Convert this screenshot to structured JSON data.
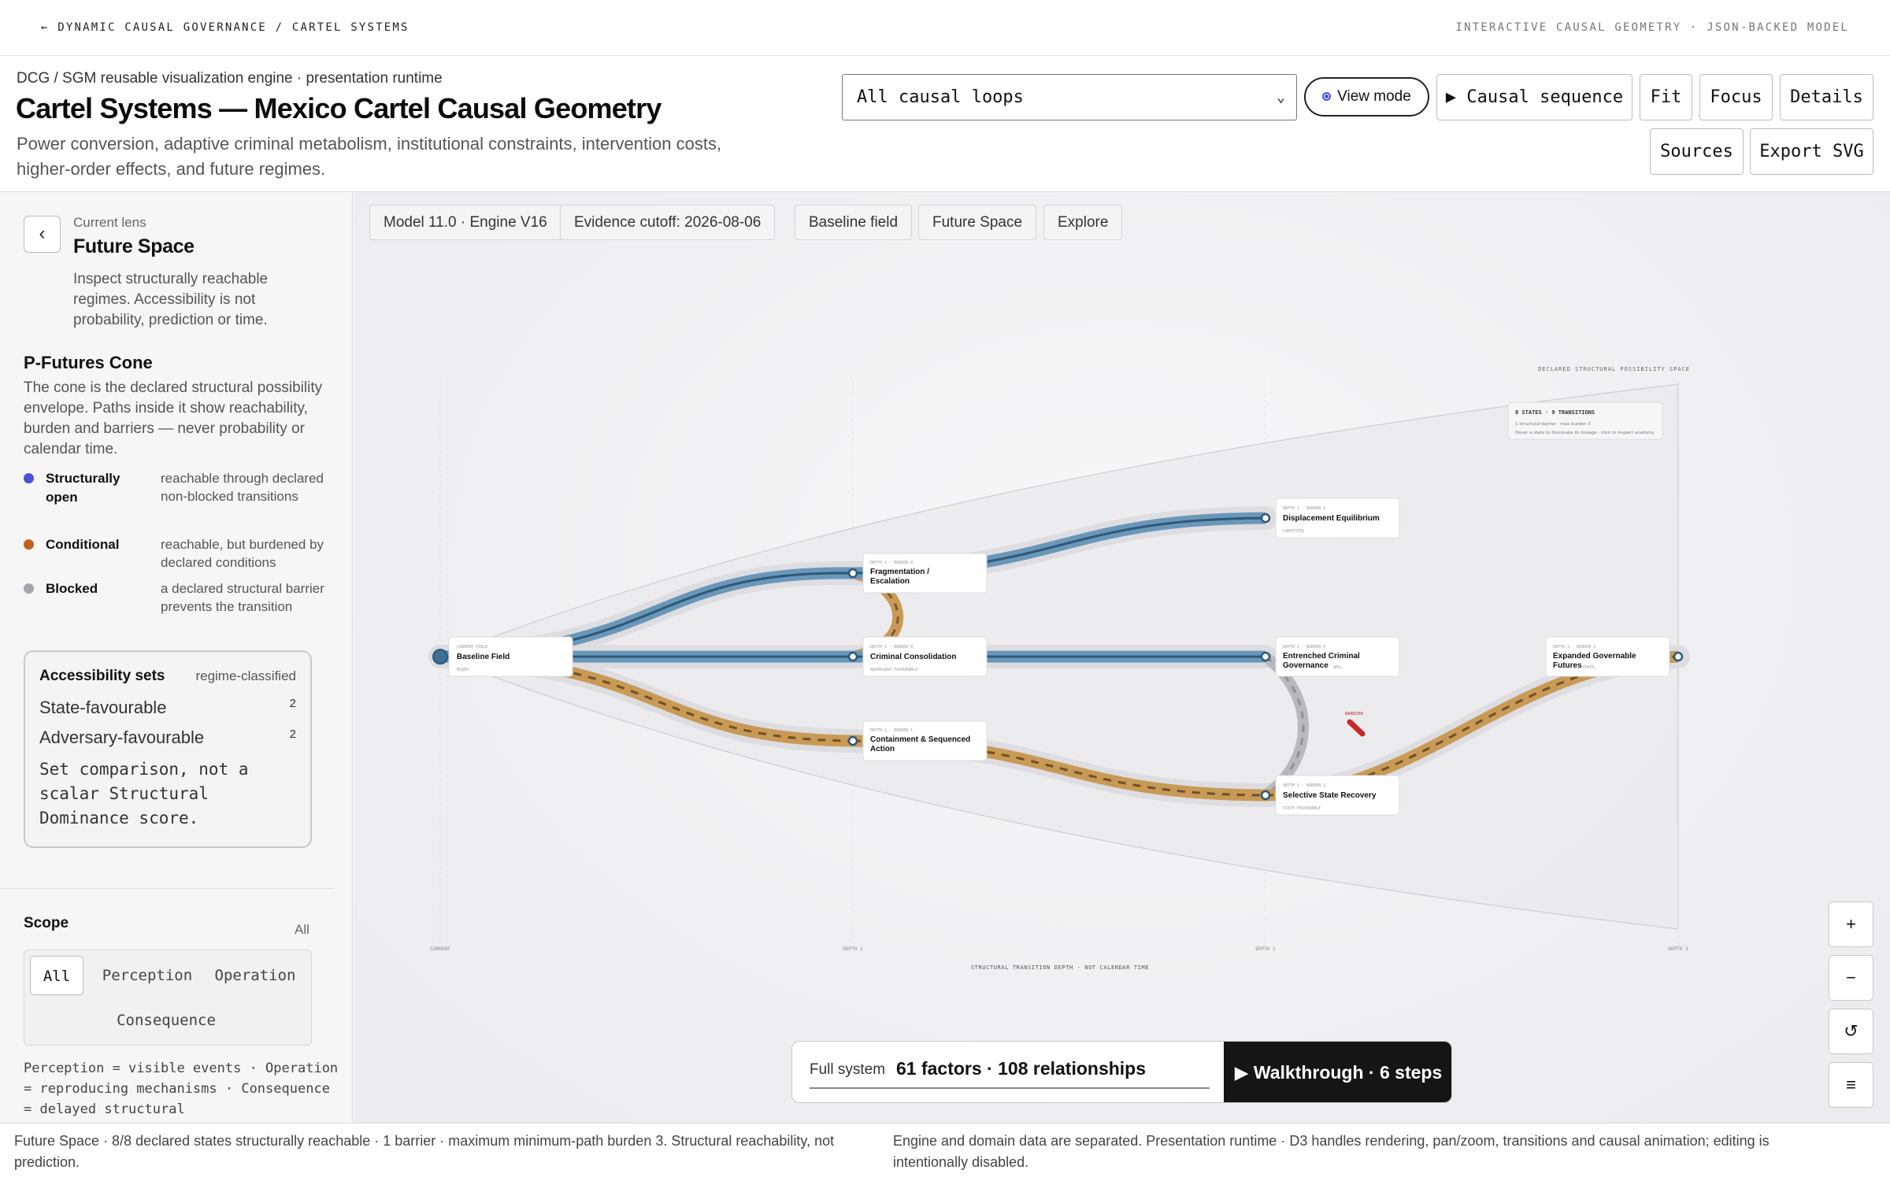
{
  "topbar": {
    "back": "← DYNAMIC CAUSAL GOVERNANCE / CARTEL SYSTEMS",
    "right": "INTERACTIVE CAUSAL GEOMETRY · JSON-BACKED MODEL"
  },
  "header": {
    "crumb": "DCG / SGM reusable visualization engine · presentation runtime",
    "title": "Cartel Systems — Mexico Cartel Causal Geometry",
    "subtitle": "Power conversion, adaptive criminal metabolism, institutional constraints, intervention costs, higher-order effects, and future regimes.",
    "loop_select": "All causal loops",
    "view_mode": "View mode",
    "buttons": {
      "causal_sequence": "▶ Causal sequence",
      "fit": "Fit",
      "focus": "Focus",
      "details": "Details",
      "sources": "Sources",
      "export": "Export SVG"
    }
  },
  "sidebar": {
    "lens_caption": "Current lens",
    "lens_title": "Future Space",
    "lens_desc": "Inspect structurally reachable regimes. Accessibility is not probability, prediction or time.",
    "cone_title": "P-Futures Cone",
    "cone_desc": "The cone is the declared structural possibility envelope. Paths inside it show reachability, burden and barriers — never probability or calendar time.",
    "legend": [
      {
        "name": "Structurally open",
        "def": "reachable through declared non-blocked transitions",
        "color": "#4a4fe0"
      },
      {
        "name": "Conditional",
        "def": "reachable, but burdened by declared conditions",
        "color": "#c2601c"
      },
      {
        "name": "Blocked",
        "def": "a declared structural barrier prevents the transition",
        "color": "#a5a5ab"
      }
    ],
    "access": {
      "title": "Accessibility sets",
      "tag": "regime-classified",
      "rows": [
        {
          "label": "State-favourable",
          "count": "2"
        },
        {
          "label": "Adversary-favourable",
          "count": "2"
        }
      ],
      "note": "Set comparison, not a scalar Structural Dominance score."
    },
    "scope": {
      "title": "Scope",
      "all_link": "All",
      "options": [
        "All",
        "Perception",
        "Operation",
        "Consequence"
      ],
      "note": "Perception = visible events · Operation = reproducing mechanisms · Consequence = delayed structural"
    }
  },
  "canvas": {
    "chips": [
      "Model 11.0 · Engine V16",
      "Evidence cutoff: 2026-08-06",
      "Baseline field",
      "Future Space",
      "Explore"
    ],
    "cone_label": "DECLARED STRUCTURAL POSSIBILITY SPACE",
    "summary": {
      "title": "8 STATES · 9 TRANSITIONS",
      "line1": "1 structural barrier · max burden 3",
      "line2": "Hover a state to illuminate its lineage · click to inspect anatomy"
    },
    "depth_labels": [
      "CURRENT",
      "DEPTH 1",
      "DEPTH 2",
      "DEPTH 3"
    ],
    "axis_caption": "STRUCTURAL TRANSITION DEPTH · NOT CALENDAR TIME",
    "barrier_label": "BARRIER",
    "nodes": {
      "baseline": {
        "meta": "CURRENT FIELD",
        "title": "Baseline Field",
        "foot": "MIXED"
      },
      "fragmentation": {
        "meta": "DEPTH 1 · BURDEN 0",
        "title": "Fragmentation / Escalation",
        "foot": ""
      },
      "consolidation": {
        "meta": "DEPTH 1 · BURDEN 0",
        "title": "Criminal Consolidation",
        "foot": "ADVERSARY-FAVOURABLE"
      },
      "containment": {
        "meta": "DEPTH 1 · BURDEN 1",
        "title": "Containment & Sequenced Action",
        "foot": ""
      },
      "displacement": {
        "meta": "DEPTH 2 · BURDEN 0",
        "title": "Displacement Equilibrium",
        "foot": "CONTESTED"
      },
      "entrenched": {
        "meta": "DEPTH 2 · BURDEN 0",
        "title": "Entrenched Criminal Governance",
        "foot": "ADVERSARY-FAVOURABLE"
      },
      "recovery": {
        "meta": "DEPTH 2 · BURDEN 2",
        "title": "Selective State Recovery",
        "foot": "STATE-FAVOURABLE"
      },
      "expanded": {
        "meta": "DEPTH 3 · BURDEN 3",
        "title": "Expanded Governable Futures",
        "foot": "STATE-FAVOURABLE"
      }
    },
    "zoom": {
      "in": "+",
      "out": "−",
      "reset": "↺",
      "menu": "≡"
    }
  },
  "system": {
    "label": "Full system",
    "value": "61 factors · 108 relationships",
    "walkthrough": "▶ Walkthrough · 6 steps"
  },
  "footer": {
    "left": "Future Space · 8/8 declared states structurally reachable · 1 barrier · maximum minimum-path burden 3. Structural reachability, not prediction.",
    "right": "Engine and domain data are separated. Presentation runtime · D3 handles rendering, pan/zoom, transitions and causal animation; editing is intentionally disabled."
  },
  "colors": {
    "open_path": "#5f8eaf",
    "conditional_path": "#c89a55",
    "blocked_path": "#b9b9bd",
    "barrier": "#c8282c",
    "accent": "#4a4fe0"
  }
}
